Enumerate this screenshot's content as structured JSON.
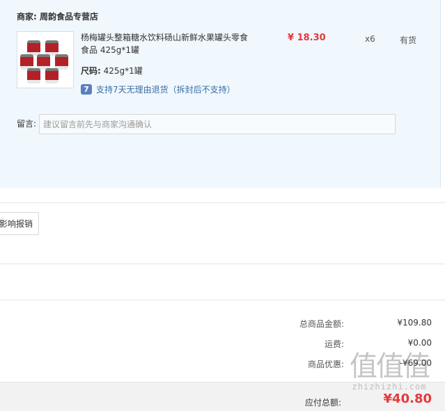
{
  "shop": {
    "label": "商家: 周韵食品专营店"
  },
  "product": {
    "title": "杨梅罐头整箱糖水饮料砀山新鲜水果罐头零食食品 425g*1罐",
    "size_label": "尺码:",
    "size_value": "425g*1罐",
    "return_icon": "7",
    "return_text": "支持7天无理由退货（拆封后不支持）",
    "price": "¥ 18.30",
    "qty": "x6",
    "stock": "有货",
    "image_icon": "canned-fruit-product-image"
  },
  "message": {
    "label": "留言:",
    "placeholder": "建议留言前先与商家沟通确认"
  },
  "invoice": {
    "button_label": "影响报销"
  },
  "summary": {
    "goods_total_label": "总商品金额:",
    "goods_total_value": "¥109.80",
    "shipping_label": "运费:",
    "shipping_value": "¥0.00",
    "discount_label": "商品优惠:",
    "discount_value": "-¥69.00",
    "payable_label": "应付总额:",
    "payable_value": "¥40.80"
  },
  "watermark": {
    "top": "值值值",
    "bottom": "zhizhizhi.com"
  },
  "colors": {
    "accent_price": "#e4393c",
    "panel_bg": "#f0f7fd",
    "link_blue": "#3a6ea5"
  }
}
